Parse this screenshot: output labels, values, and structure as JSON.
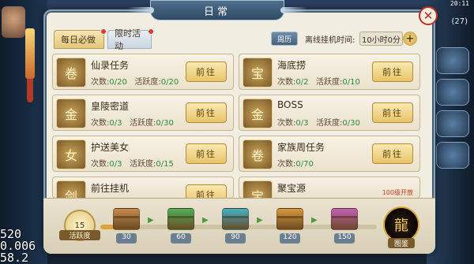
{
  "status": {
    "time": "20:11",
    "side_number": "(27)"
  },
  "fps_overlay": [
    "520",
    "0.006",
    "58.2"
  ],
  "window": {
    "title": "日常",
    "close_icon": "close-icon"
  },
  "tabs": [
    {
      "label": "每日必做",
      "active": true,
      "red_dot": true
    },
    {
      "label": "限时活动",
      "active": false,
      "red_dot": true
    }
  ],
  "header": {
    "calendar_label": "周历",
    "offline_label": "离线挂机时间:",
    "offline_value": "10小时0分",
    "plus_icon": "plus-icon"
  },
  "tasks": [
    {
      "name": "仙录任务",
      "count_label": "次数:",
      "count": "0/20",
      "activity_label": "活跃度:",
      "activity": "0/20",
      "button": "前往",
      "icon": "scroll-icon"
    },
    {
      "name": "海底捞",
      "count_label": "次数:",
      "count": "0/2",
      "activity_label": "活跃度:",
      "activity": "0/10",
      "button": "前往",
      "icon": "treasure-pot-icon"
    },
    {
      "name": "皇陵密道",
      "count_label": "次数:",
      "count": "0/3",
      "activity_label": "活跃度:",
      "activity": "0/30",
      "button": "前往",
      "icon": "gold-ingot-icon"
    },
    {
      "name": "BOSS",
      "count_label": "次数:",
      "count": "0/3",
      "activity_label": "活跃度:",
      "activity": "0/30",
      "button": "前往",
      "icon": "gold-ingot-icon"
    },
    {
      "name": "护送美女",
      "count_label": "次数:",
      "count": "0/3",
      "activity_label": "活跃度:",
      "activity": "0/15",
      "button": "前往",
      "icon": "lady-portrait-icon"
    },
    {
      "name": "家族周任务",
      "count_label": "次数:",
      "count": "0/70",
      "activity_label": "",
      "activity": "",
      "button": "前往",
      "icon": "scroll-icon"
    },
    {
      "name": "前往挂机",
      "count_label": "",
      "count": "",
      "activity_label": "",
      "activity": "",
      "button": "前往",
      "icon": "sword-icon"
    },
    {
      "name": "聚宝源",
      "count_label": "",
      "count": "",
      "activity_label": "",
      "activity": "",
      "button": "",
      "extra": "100级开放",
      "icon": "treasure-icon"
    }
  ],
  "progress": {
    "activity_value": "15",
    "activity_label": "活跃度",
    "fill_fraction": 0.05,
    "milestones": [
      {
        "value": "30",
        "color": "#c88a4a"
      },
      {
        "value": "60",
        "color": "#4fb05a"
      },
      {
        "value": "90",
        "color": "#3fb3c8"
      },
      {
        "value": "120",
        "color": "#d79a3a"
      },
      {
        "value": "150",
        "color": "#c45fb8"
      }
    ],
    "guide_label": "图鉴"
  }
}
